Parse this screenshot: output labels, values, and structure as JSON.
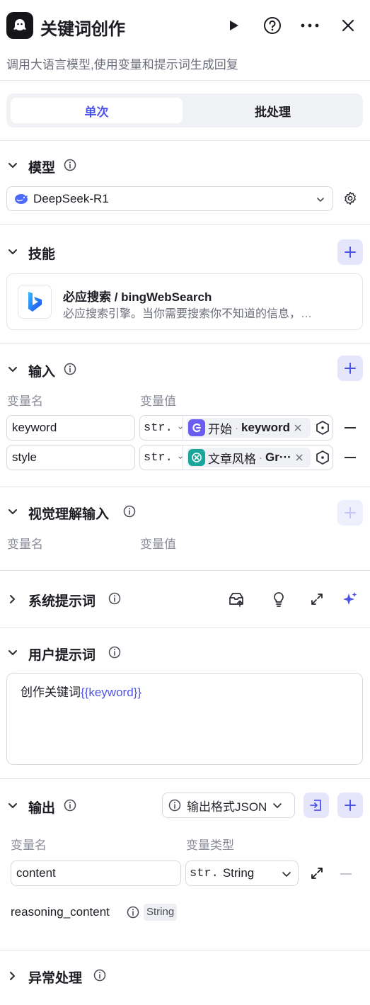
{
  "header": {
    "title": "关键词创作",
    "subtitle": "调用大语言模型,使用变量和提示词生成回复"
  },
  "tabs": {
    "single": "单次",
    "batch": "批处理"
  },
  "model": {
    "section_title": "模型",
    "selected": "DeepSeek-R1"
  },
  "skills": {
    "section_title": "技能",
    "item_title": "必应搜索 / bingWebSearch",
    "item_desc": "必应搜索引擎。当你需要搜索你不知道的信息，…"
  },
  "inputs": {
    "section_title": "输入",
    "col_name": "变量名",
    "col_value": "变量值",
    "rows": [
      {
        "name": "keyword",
        "type": "str.",
        "source_node": "开始",
        "source_sep": "·",
        "source_var": "keyword"
      },
      {
        "name": "style",
        "type": "str.",
        "source_node": "文章风格",
        "source_sep": "·",
        "source_var": "Gr···"
      }
    ]
  },
  "vision": {
    "section_title": "视觉理解输入",
    "col_name": "变量名",
    "col_value": "变量值"
  },
  "system_prompt": {
    "section_title": "系统提示词"
  },
  "user_prompt": {
    "section_title": "用户提示词",
    "text": "创作关键词",
    "variable": "{{keyword}}"
  },
  "output": {
    "section_title": "输出",
    "format_label": "输出格式JSON",
    "col_name": "变量名",
    "col_type": "变量类型",
    "rows": [
      {
        "name": "content",
        "type_prefix": "str.",
        "type": "String"
      }
    ],
    "reasoning_name": "reasoning_content",
    "reasoning_type": "String"
  },
  "exception": {
    "section_title": "异常处理"
  },
  "colors": {
    "accent": "#4d53e8",
    "accent_light": "#e5e6fc",
    "start_node": "#6b5cf0",
    "style_node": "#1aa69a"
  }
}
